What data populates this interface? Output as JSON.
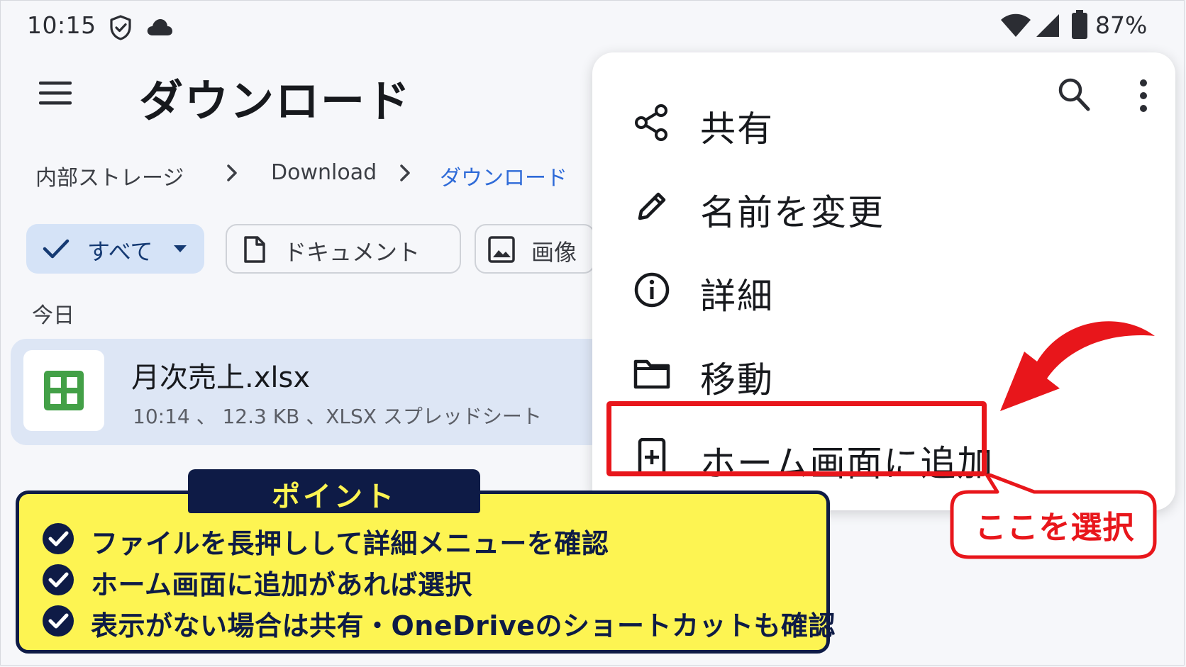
{
  "status_bar": {
    "time": "10:15",
    "battery": "87%",
    "icons": [
      "shield-check-icon",
      "cloud-icon",
      "wifi-icon",
      "signal-icon",
      "battery-icon"
    ]
  },
  "app_bar": {
    "title": "ダウンロード"
  },
  "breadcrumb": [
    "内部ストレージ",
    "Download",
    "ダウンロード"
  ],
  "filters": {
    "all": "すべて",
    "documents": "ドキュメント",
    "images": "画像"
  },
  "section": "今日",
  "file": {
    "name": "月次売上.xlsx",
    "meta": "10:14 、 12.3 KB 、XLSX スプレッドシート"
  },
  "context_menu": {
    "items": [
      {
        "label": "共有",
        "icon": "share-icon"
      },
      {
        "label": "名前を変更",
        "icon": "pencil-icon"
      },
      {
        "label": "詳細",
        "icon": "info-icon"
      },
      {
        "label": "移動",
        "icon": "folder-icon"
      },
      {
        "label": "ホーム画面に追加",
        "icon": "add-to-home-icon"
      }
    ]
  },
  "annotation": {
    "callout": "ここを選択",
    "point_title": "ポイント",
    "points": [
      "ファイルを長押しして詳細メニューを確認",
      "ホーム画面に追加があれば選択",
      "表示がない場合は共有・OneDriveのショートカットも確認"
    ]
  },
  "colors": {
    "accent_blue": "#2f6bd8",
    "highlight_red": "#e8161b",
    "point_yellow": "#fdf452",
    "navy": "#0e1b46",
    "sheets_green": "#43a047"
  }
}
